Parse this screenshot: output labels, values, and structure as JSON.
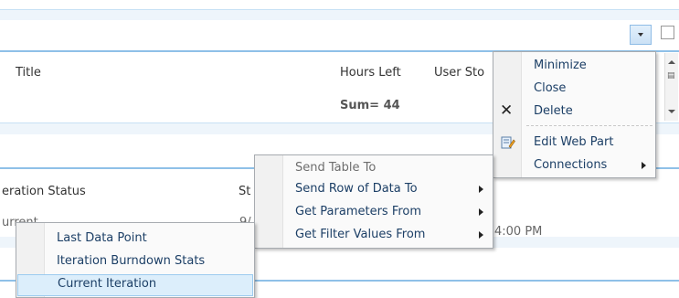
{
  "list_header": {
    "col_title": "Title",
    "col_hours_left": "Hours Left",
    "col_user_story": "User Sto",
    "sum_label": "Sum= 44"
  },
  "status_section": {
    "col_iteration_status": "eration Status",
    "col_st": "St",
    "val_current": "urrent",
    "val_date": "9/",
    "val_time": "4:00 PM"
  },
  "webpart_menu": {
    "items": [
      {
        "label": "Minimize"
      },
      {
        "label": "Close"
      },
      {
        "label": "Delete"
      },
      {
        "label": "Edit Web Part"
      },
      {
        "label": "Connections"
      }
    ]
  },
  "connections_submenu": {
    "items": [
      {
        "label": "Send Table To"
      },
      {
        "label": "Send Row of Data To"
      },
      {
        "label": "Get Parameters From"
      },
      {
        "label": "Get Filter Values From"
      }
    ]
  },
  "datapoint_menu": {
    "items": [
      {
        "label": "Last Data Point"
      },
      {
        "label": "Iteration Burndown Stats"
      },
      {
        "label": "Current Iteration"
      }
    ]
  },
  "colors": {
    "accent_line": "#8fc0e8",
    "menu_text": "#1c3f66",
    "highlight": "#dceefb"
  }
}
